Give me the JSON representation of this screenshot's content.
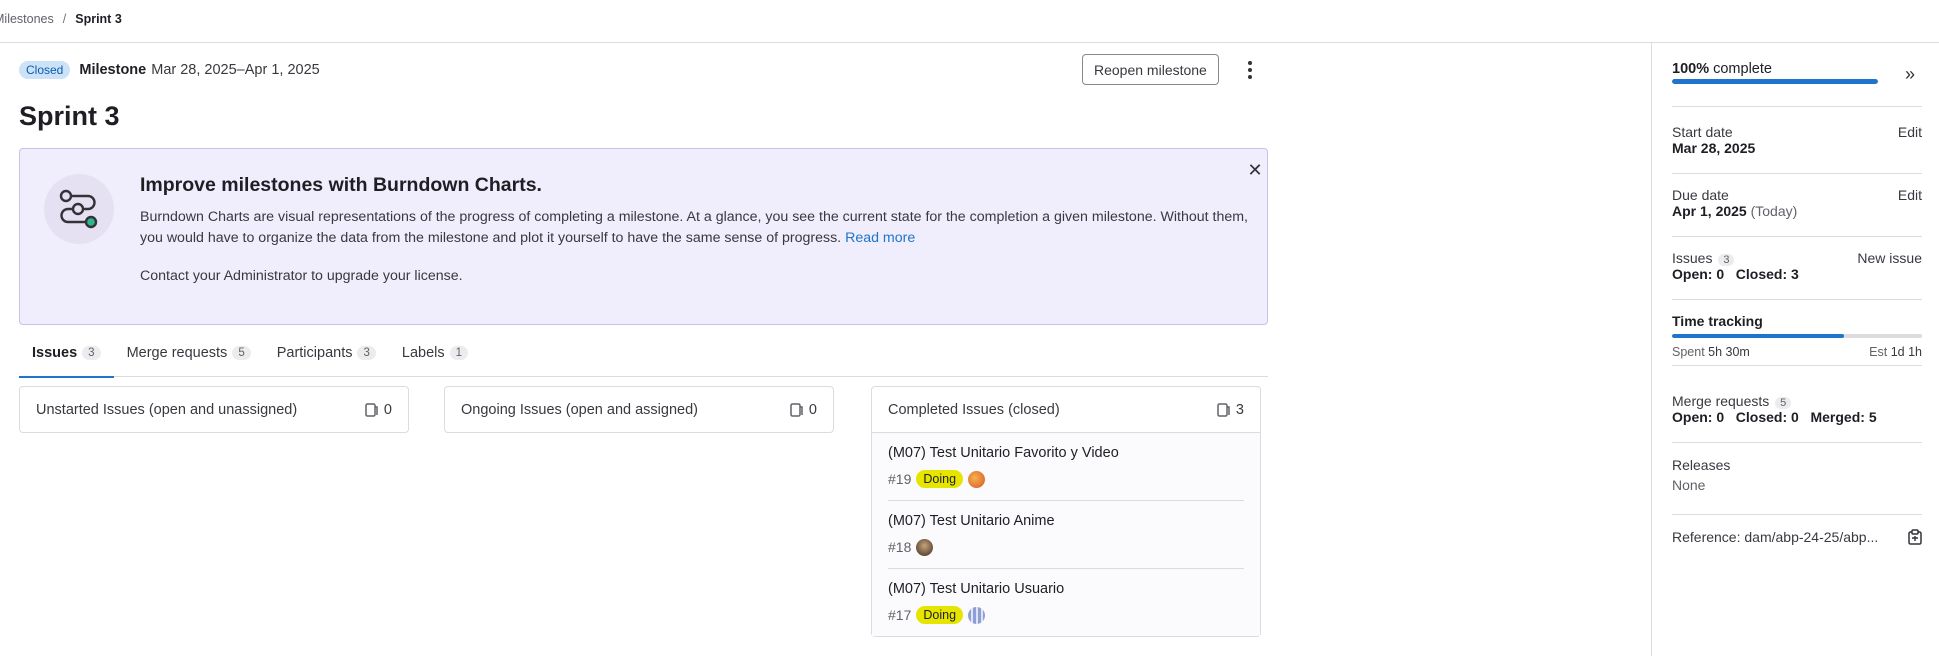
{
  "breadcrumb": {
    "parent": "Milestones",
    "current": "Sprint 3"
  },
  "header": {
    "status_badge": "Closed",
    "milestone_label": "Milestone",
    "dates": "Mar 28, 2025–Apr 1, 2025",
    "reopen_button": "Reopen milestone"
  },
  "page_title": "Sprint 3",
  "promo": {
    "title": "Improve milestones with Burndown Charts.",
    "body": "Burndown Charts are visual representations of the progress of completing a milestone. At a glance, you see the current state for the completion a given milestone. Without them, you would have to organize the data from the milestone and plot it yourself to have the same sense of progress.",
    "read_more": "Read more",
    "contact": "Contact your Administrator to upgrade your license."
  },
  "tabs": [
    {
      "label": "Issues",
      "count": "3"
    },
    {
      "label": "Merge requests",
      "count": "5"
    },
    {
      "label": "Participants",
      "count": "3"
    },
    {
      "label": "Labels",
      "count": "1"
    }
  ],
  "columns": {
    "unstarted": {
      "title": "Unstarted Issues (open and unassigned)",
      "count": "0"
    },
    "ongoing": {
      "title": "Ongoing Issues (open and assigned)",
      "count": "0"
    },
    "completed": {
      "title": "Completed Issues (closed)",
      "count": "3",
      "issues": [
        {
          "title": "(M07) Test Unitario Favorito y Video",
          "ref": "#19",
          "label": "Doing"
        },
        {
          "title": "(M07) Test Unitario Anime",
          "ref": "#18",
          "label": ""
        },
        {
          "title": "(M07) Test Unitario Usuario",
          "ref": "#17",
          "label": "Doing"
        }
      ]
    }
  },
  "sidebar": {
    "progress": {
      "text": "100% complete",
      "percent_bold": "100%",
      "percent_rest": " complete",
      "fraction": 1.0
    },
    "start_date": {
      "label": "Start date",
      "value": "Mar 28, 2025",
      "edit": "Edit"
    },
    "due_date": {
      "label": "Due date",
      "value": "Apr 1, 2025",
      "suffix": "(Today)",
      "edit": "Edit"
    },
    "issues": {
      "label": "Issues",
      "count": "3",
      "new_issue": "New issue",
      "open": "Open: 0",
      "closed": "Closed: 3"
    },
    "time_tracking": {
      "label": "Time tracking",
      "spent_label": "Spent",
      "spent": "5h 30m",
      "est_label": "Est",
      "est": "1d 1h",
      "fraction": 0.6875
    },
    "merge_requests": {
      "label": "Merge requests",
      "count": "5",
      "open": "Open: 0",
      "closed": "Closed: 0",
      "merged": "Merged: 5"
    },
    "releases": {
      "label": "Releases",
      "value": "None"
    },
    "reference": {
      "text": "Reference: dam/abp-24-25/abp..."
    }
  },
  "colors": {
    "accent": "#1f75cb",
    "promo_bg": "#f0edfc",
    "label_doing": "#e5e500",
    "badge_closed": "#cbe2f9"
  }
}
